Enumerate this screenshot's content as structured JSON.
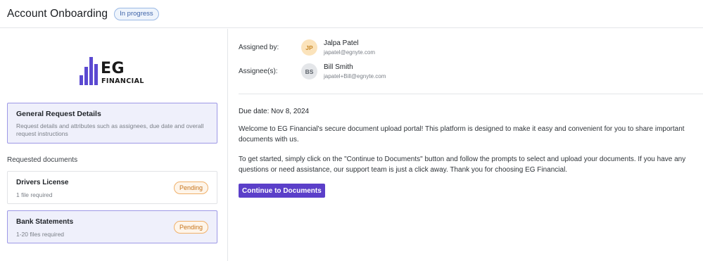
{
  "header": {
    "title": "Account Onboarding",
    "status": "In progress"
  },
  "logo": {
    "brand": "EG",
    "subtitle": "FINANCIAL",
    "color": "#5b49d1"
  },
  "general_request": {
    "title": "General Request Details",
    "description": "Request details and attributes such as assignees, due date and overall request instructions"
  },
  "requested_documents": {
    "label": "Requested documents",
    "items": [
      {
        "title": "Drivers License",
        "requirement": "1 file required",
        "status": "Pending",
        "selected": false
      },
      {
        "title": "Bank Statements",
        "requirement": "1-20 files required",
        "status": "Pending",
        "selected": true
      }
    ]
  },
  "assignment": {
    "assigned_by_label": "Assigned by:",
    "assigned_by": {
      "initials": "JP",
      "name": "Jalpa Patel",
      "email": "japatel@egnyte.com"
    },
    "assignees_label": "Assignee(s):",
    "assignee": {
      "initials": "BS",
      "name": "Bill Smith",
      "email": "japatel+Bill@egnyte.com"
    }
  },
  "details": {
    "due_date": "Due date: Nov 8, 2024",
    "welcome_text": "Welcome to EG Financial's secure document upload portal! This platform is designed to make it easy and convenient for you to share important documents with us.",
    "instructions_text": "To get started, simply click on the \"Continue to Documents\" button and follow the prompts to select and upload your documents. If you have any questions or need assistance, our support team is just a click away. Thank you for choosing EG Financial.",
    "cta_label": "Continue to Documents"
  },
  "colors": {
    "accent": "#5b3fc9",
    "selected_border": "#9d98e6",
    "pending": "#c7741b",
    "in_progress": "#3f64a8"
  }
}
